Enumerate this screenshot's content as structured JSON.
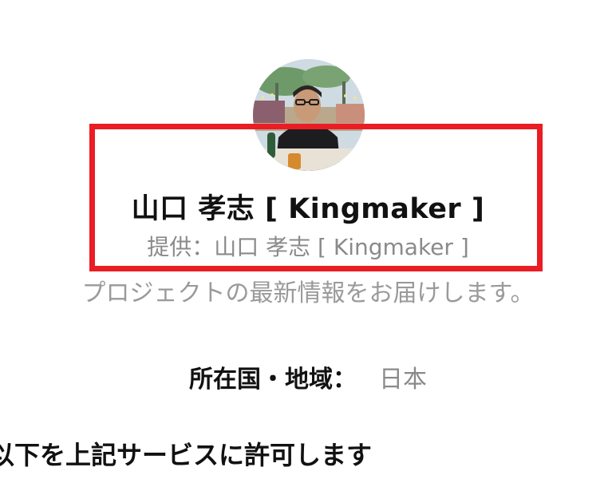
{
  "profile": {
    "avatar_icon": "profile-photo",
    "display_name": "山口 孝志 [ Kingmaker ]",
    "provider_line": "提供：山口 孝志 [ Kingmaker ]",
    "description": "プロジェクトの最新情報をお届けします。"
  },
  "country": {
    "label": "所在国・地域：",
    "value": "日本"
  },
  "permissions": {
    "title": "以下を上記サービスに許可します"
  },
  "colors": {
    "highlight": "#ea1d24",
    "primary_text": "#111111",
    "secondary_text": "#8a8a8a"
  }
}
